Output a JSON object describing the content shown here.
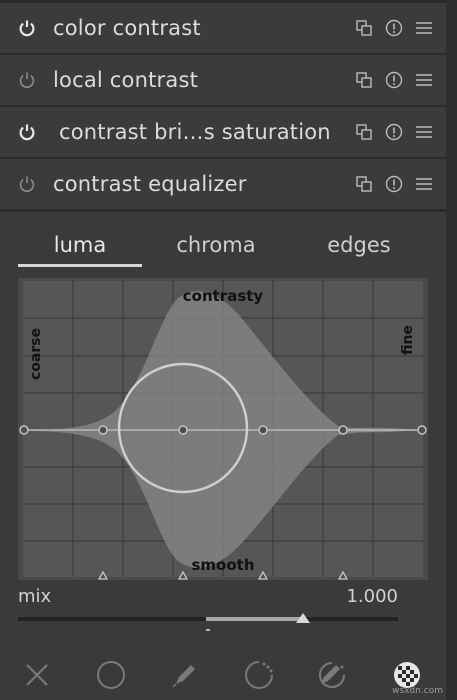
{
  "modules": [
    {
      "label": "color contrast",
      "power_on": true
    },
    {
      "label": "local contrast",
      "power_on": false
    },
    {
      "label": "contrast bri…s saturation",
      "power_on": true
    },
    {
      "label": "contrast equalizer",
      "power_on": false
    }
  ],
  "module_icons": [
    "multi-instance-icon",
    "reset-icon",
    "presets-icon"
  ],
  "tabs": [
    {
      "label": "luma",
      "active": true
    },
    {
      "label": "chroma",
      "active": false
    },
    {
      "label": "edges",
      "active": false
    }
  ],
  "graph": {
    "top_label": "contrasty",
    "bottom_label": "smooth",
    "left_label": "coarse",
    "right_label": "fine"
  },
  "mix": {
    "label": "mix",
    "value": "1.000",
    "level": 1.0
  },
  "toolbar": [
    "close-icon",
    "circle-mask-icon",
    "drawn-mask-icon",
    "parametric-mask-icon",
    "drawn-parametric-mask-icon",
    "raster-mask-icon"
  ],
  "watermark": "wsxdn.com",
  "colors": {
    "bg": "#2b2b2b",
    "row": "#3b3b3b",
    "panel": "#3a3a3a",
    "text": "#d8d8d8"
  }
}
